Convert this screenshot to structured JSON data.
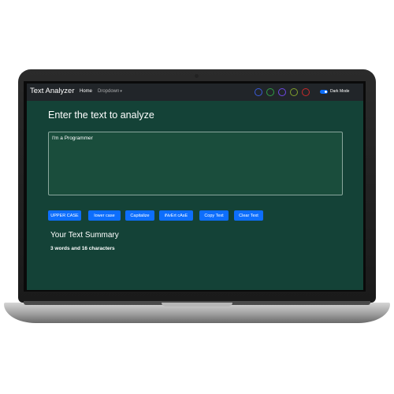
{
  "navbar": {
    "brand": "Text Analyzer",
    "home": "Home",
    "dropdown": "Dropdown",
    "dark_mode_label": "Dark Mode",
    "dark_mode_on": true,
    "theme_swatches": [
      {
        "name": "blue-theme",
        "color": "#3b5bdb"
      },
      {
        "name": "green-theme",
        "color": "#2f9e44"
      },
      {
        "name": "purple-theme",
        "color": "#7048e8"
      },
      {
        "name": "olive-theme",
        "color": "#82a02b"
      },
      {
        "name": "red-theme",
        "color": "#c92a2a"
      }
    ]
  },
  "main": {
    "heading": "Enter the text to analyze",
    "textarea_value": "I'm a Programmer",
    "buttons": [
      "UPPER CASE",
      "lower case",
      "Capitalize",
      "iNvErt cAsE",
      "Copy Text",
      "Clear Text"
    ]
  },
  "summary": {
    "title": "Your Text Summary",
    "text": "3 words and 16 characters"
  },
  "colors": {
    "background": "#144237",
    "navbar": "#212529",
    "button": "#0d6efd"
  }
}
